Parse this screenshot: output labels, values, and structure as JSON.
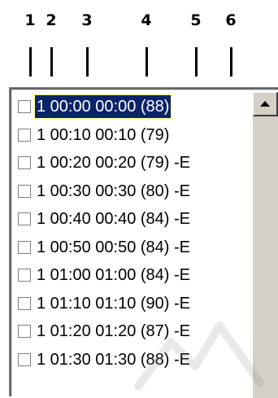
{
  "callouts": [
    "1",
    "2",
    "3",
    "4",
    "5",
    "6"
  ],
  "list": {
    "items": [
      {
        "label": "1 00:00 00:00 (88)",
        "checked": false,
        "selected": true
      },
      {
        "label": "1 00:10 00:10 (79)",
        "checked": false,
        "selected": false
      },
      {
        "label": "1 00:20 00:20 (79) -E",
        "checked": false,
        "selected": false
      },
      {
        "label": "1 00:30 00:30 (80) -E",
        "checked": false,
        "selected": false
      },
      {
        "label": "1 00:40 00:40 (84) -E",
        "checked": false,
        "selected": false
      },
      {
        "label": "1 00:50 00:50 (84) -E",
        "checked": false,
        "selected": false
      },
      {
        "label": "1 01:00 01:00 (84) -E",
        "checked": false,
        "selected": false
      },
      {
        "label": "1 01:10 01:10 (90) -E",
        "checked": false,
        "selected": false
      },
      {
        "label": "1 01:20 01:20 (87) -E",
        "checked": false,
        "selected": false
      },
      {
        "label": "1 01:30 01:30 (88) -E",
        "checked": false,
        "selected": false
      }
    ]
  },
  "colors": {
    "selection_background": "#0a246a",
    "selection_text": "#ffffff",
    "scrollbar_face": "#d4d0c8"
  },
  "icons": {
    "scroll_up": "scroll-up-arrow-icon"
  }
}
